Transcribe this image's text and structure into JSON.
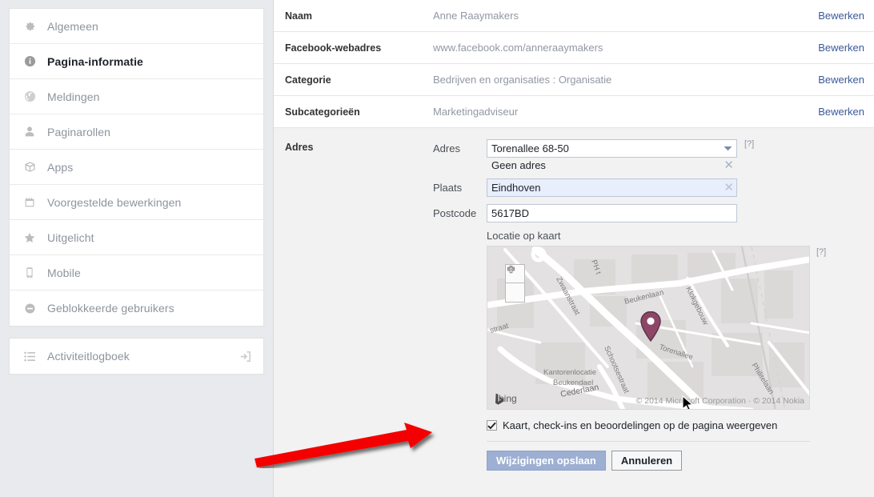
{
  "sidebar": {
    "primary_items": [
      {
        "label": "Algemeen",
        "icon": "gear-icon",
        "active": false
      },
      {
        "label": "Pagina-informatie",
        "icon": "info-icon",
        "active": true
      },
      {
        "label": "Meldingen",
        "icon": "globe-icon",
        "active": false
      },
      {
        "label": "Paginarollen",
        "icon": "person-icon",
        "active": false
      },
      {
        "label": "Apps",
        "icon": "box-icon",
        "active": false
      },
      {
        "label": "Voorgestelde bewerkingen",
        "icon": "calendar-icon",
        "active": false
      },
      {
        "label": "Uitgelicht",
        "icon": "star-icon",
        "active": false
      },
      {
        "label": "Mobile",
        "icon": "phone-icon",
        "active": false
      },
      {
        "label": "Geblokkeerde gebruikers",
        "icon": "minus-circle-icon",
        "active": false
      }
    ],
    "secondary_items": [
      {
        "label": "Activiteitlogboek",
        "icon": "list-icon",
        "trailing_icon": "external-link-icon"
      }
    ]
  },
  "info_rows": [
    {
      "label": "Naam",
      "value": "Anne Raaymakers",
      "edit": "Bewerken"
    },
    {
      "label": "Facebook-webadres",
      "value": "www.facebook.com/anneraaymakers",
      "edit": "Bewerken"
    },
    {
      "label": "Categorie",
      "value": "Bedrijven en organisaties : Organisatie",
      "edit": "Bewerken"
    },
    {
      "label": "Subcategorieën",
      "value": "Marketingadviseur",
      "edit": "Bewerken"
    }
  ],
  "address": {
    "section_label": "Adres",
    "street": {
      "label": "Adres",
      "value": "Torenallee 68-50",
      "placeholder": "Adres",
      "suggestion": "Geen adres",
      "help": "[?]"
    },
    "city": {
      "label": "Plaats",
      "value": "Eindhoven",
      "placeholder": "Plaats"
    },
    "postcode": {
      "label": "Postcode",
      "value": "5617BD",
      "placeholder": "Postcode"
    },
    "map": {
      "heading": "Locatie op kaart",
      "help": "[?]",
      "provider": "bing",
      "copyright": "© 2014 Microsoft Corporation · © 2014 Nokia",
      "zoom_in": "+",
      "zoom_out": "−",
      "pin_color": "#8d4668",
      "street_labels": [
        "Zwaanstraat",
        "Beukenlaan",
        "Klokgebouw",
        "Torenallee",
        "Philitelaan",
        "Schootsestraat",
        "Cederlaan",
        "PH t",
        "straat"
      ],
      "place_labels": [
        "Kantorenlocatie",
        "Beukendael"
      ]
    }
  },
  "show_map_checkbox": {
    "label": "Kaart, check-ins en beoordelingen op de pagina weergeven",
    "checked": true
  },
  "buttons": {
    "save": "Wijzigingen opslaan",
    "cancel": "Annuleren"
  },
  "annotation": {
    "arrow_color": "#f40000"
  },
  "colors": {
    "link": "#3b5998",
    "primary_button": "#9dafd2",
    "page_background": "#e9eaed",
    "panel_background": "#f2f2f2",
    "autofill_field": "#e8eefb"
  }
}
